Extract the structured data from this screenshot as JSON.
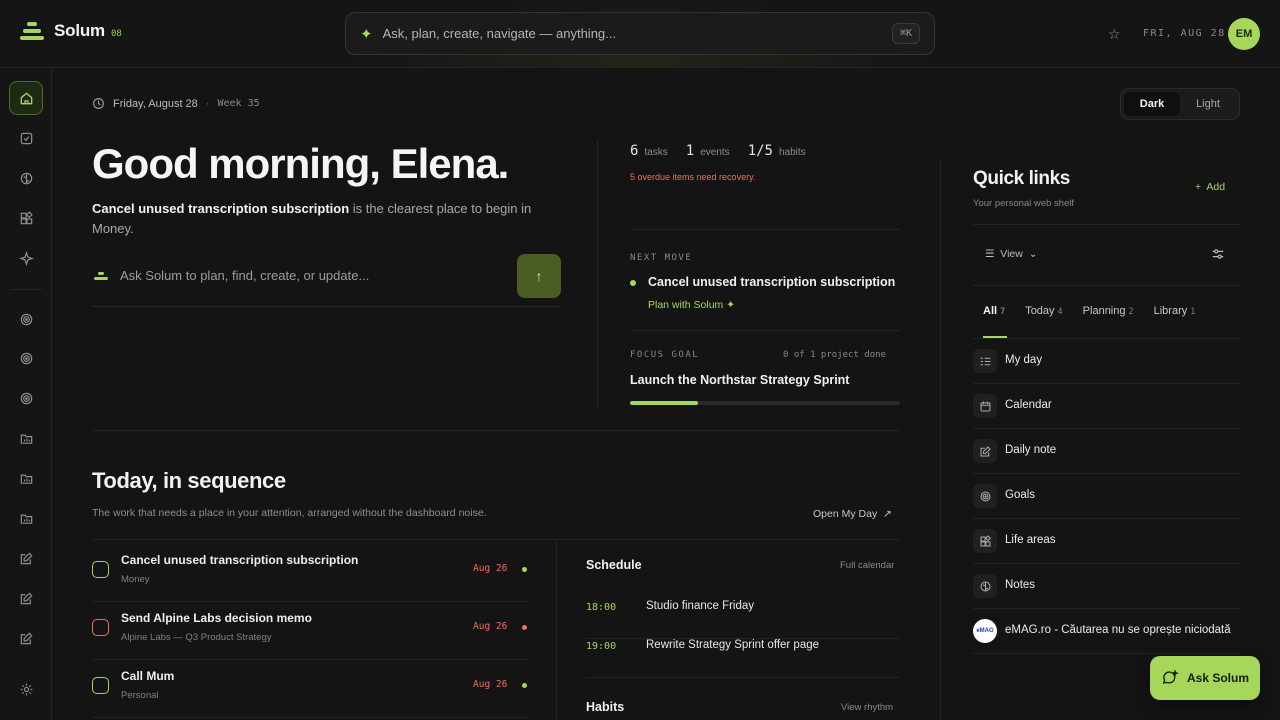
{
  "app": {
    "name": "Solum",
    "version": "08"
  },
  "search": {
    "placeholder": "Ask, plan, create, navigate — anything...",
    "shortcut": "⌘K"
  },
  "header": {
    "date": "FRI, AUG 28",
    "avatar_initials": "EM"
  },
  "main": {
    "date": "Friday, August 28",
    "week": "Week 35",
    "theme": {
      "dark": "Dark",
      "light": "Light",
      "selected": "Dark"
    },
    "greeting": "Good morning, Elena.",
    "suggestion_bold": "Cancel unused transcription subscription",
    "suggestion_rest": " is the clearest place to begin in Money.",
    "ask_placeholder": "Ask Solum to plan, find, create, or update..."
  },
  "stats": {
    "tasks": {
      "value": "6",
      "label": "tasks"
    },
    "events": {
      "value": "1",
      "label": "events"
    },
    "habits": {
      "value": "1/5",
      "label": "habits"
    },
    "overdue": "5 overdue items need recovery."
  },
  "next_move": {
    "label": "NEXT MOVE",
    "title": "Cancel unused transcription subscription",
    "action": "Plan with Solum"
  },
  "focus_goal": {
    "label": "FOCUS GOAL",
    "count": "0 of 1 project done",
    "title": "Launch the Northstar Strategy Sprint",
    "progress": 0.25
  },
  "today": {
    "title": "Today, in sequence",
    "subtitle": "The work that needs a place in your attention, arranged without the dashboard noise.",
    "open_link": "Open My Day",
    "tasks": [
      {
        "title": "Cancel unused transcription subscription",
        "sub": "Money",
        "date": "Aug 26",
        "status": "green"
      },
      {
        "title": "Send Alpine Labs decision memo",
        "sub": "Alpine Labs — Q3 Product Strategy",
        "date": "Aug 26",
        "status": "red"
      },
      {
        "title": "Call Mum",
        "sub": "Personal",
        "date": "Aug 26",
        "status": "green"
      }
    ]
  },
  "schedule": {
    "title": "Schedule",
    "link": "Full calendar",
    "events": [
      {
        "time": "18:00",
        "name": "Studio finance Friday"
      },
      {
        "time": "19:00",
        "name": "Rewrite Strategy Sprint offer page"
      }
    ]
  },
  "habits": {
    "title": "Habits",
    "link": "View rhythm"
  },
  "quick_links": {
    "title": "Quick links",
    "subtitle": "Your personal web shelf",
    "add": "Add",
    "view": "View",
    "tabs": [
      {
        "label": "All",
        "count": "7"
      },
      {
        "label": "Today",
        "count": "4"
      },
      {
        "label": "Planning",
        "count": "2"
      },
      {
        "label": "Library",
        "count": "1"
      }
    ],
    "items": [
      {
        "name": "My day",
        "icon": "list-icon"
      },
      {
        "name": "Calendar",
        "icon": "calendar-icon"
      },
      {
        "name": "Daily note",
        "icon": "edit-icon"
      },
      {
        "name": "Goals",
        "icon": "target-icon"
      },
      {
        "name": "Life areas",
        "icon": "grid-icon"
      },
      {
        "name": "Notes",
        "icon": "brain-icon"
      },
      {
        "name": "eMAG.ro - Căutarea nu se oprește niciodată",
        "icon": "emag-icon",
        "badge": "eMAG"
      }
    ]
  },
  "ask_button": {
    "label": "Ask Solum"
  },
  "colors": {
    "accent": "#a6d65a",
    "danger": "#ef7157",
    "background": "#141414"
  }
}
